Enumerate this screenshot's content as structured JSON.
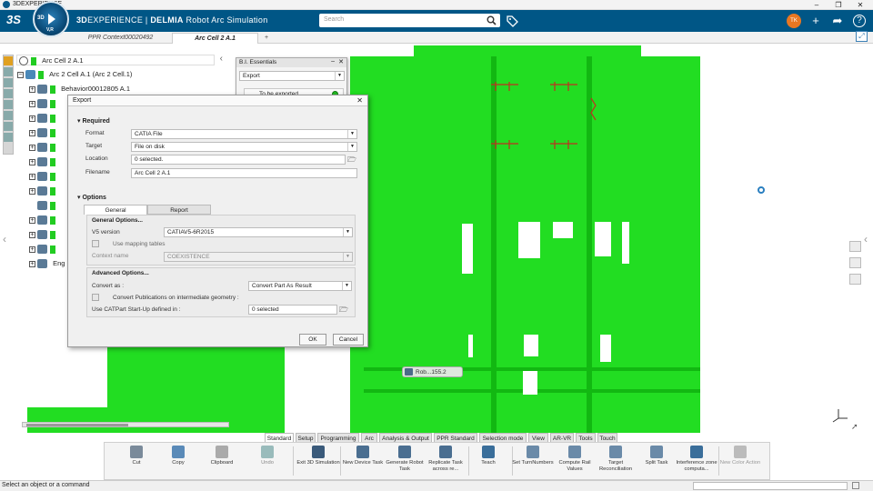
{
  "window": {
    "title": "3DEXPERIENCE",
    "minimize": "–",
    "restore": "❐",
    "close": "✕"
  },
  "topbar": {
    "brand_bold": "3D",
    "brand_rest": "EXPERIENCE | ",
    "brand_app_bold": "DELMIA",
    "brand_app": " Robot Arc Simulation",
    "compass_3d": "3D",
    "compass_version": "V,R",
    "search_placeholder": "Search",
    "user_initials": "TK",
    "icons": [
      "search-icon",
      "tag-icon",
      "add-icon",
      "share-icon",
      "help-icon"
    ],
    "add_glyph": "+",
    "share_glyph": "➦",
    "help_glyph": "?"
  },
  "tabs": {
    "items": [
      {
        "label": "PPR Context00020492"
      },
      {
        "label": "Arc Cell 2 A.1"
      }
    ],
    "add_label": "+"
  },
  "tree": {
    "collapse_arrow": "‹",
    "rows": [
      {
        "label": "Arc Cell 2 A.1"
      },
      {
        "label": "Arc 2 Cell A.1 (Arc 2 Cell.1)"
      },
      {
        "label": "Behavior00012805 A.1"
      },
      {
        "label": "Eng"
      }
    ]
  },
  "bi_essentials": {
    "title": "B.I. Essentials",
    "select_value": "Export",
    "row_label": "To be exported",
    "minimize": "–",
    "close": "✕"
  },
  "export_dialog": {
    "title": "Export",
    "close": "✕",
    "required_header": "Required",
    "format_label": "Format",
    "format_value": "CATIA File",
    "target_label": "Target",
    "target_value": "File on disk",
    "location_label": "Location",
    "location_value": "0 selected.",
    "filename_label": "Filename",
    "filename_value": "Arc Cell 2 A.1",
    "options_header": "Options",
    "subtabs": [
      "General",
      "Report"
    ],
    "general_options_header": "General Options...",
    "v5_version_label": "V5 version",
    "v5_version_value": "CATIAV5-6R2015",
    "use_mapping_label": "Use mapping tables",
    "context_name_label": "Context name",
    "context_name_value": "COEXISTENCE",
    "advanced_header": "Advanced Options...",
    "convert_as_label": "Convert as :",
    "convert_as_value": "Convert Part As Result",
    "convert_pub_label": "Convert Publications on intermediate geometry :",
    "catpart_label": "Use CATPart Start-Up defined in :",
    "catpart_value": "0 selected",
    "ok": "OK",
    "cancel": "Cancel"
  },
  "scene": {
    "tag_label": "Rob...155.2"
  },
  "section_tabs": [
    "Standard",
    "Setup",
    "Programming",
    "Arc",
    "Analysis & Output",
    "PPR Standard",
    "Selection mode",
    "View",
    "AR-VR",
    "Tools",
    "Touch"
  ],
  "actions": [
    {
      "label": "Cut",
      "icon": "scissors-icon"
    },
    {
      "label": "Copy",
      "icon": "copy-icon"
    },
    {
      "label": "Clipboard",
      "icon": "clipboard-icon"
    },
    {
      "label": "Undo",
      "icon": "undo-icon"
    },
    {
      "label": "Exit 3D Simulation",
      "icon": "exit-icon"
    },
    {
      "label": "New Device Task",
      "icon": "device-task-icon"
    },
    {
      "label": "Generate Robot Task",
      "icon": "robot-task-icon"
    },
    {
      "label": "Replicate Task across re...",
      "icon": "replicate-icon"
    },
    {
      "label": "Teach",
      "icon": "teach-icon"
    },
    {
      "label": "Set TurnNumbers",
      "icon": "turn-icon"
    },
    {
      "label": "Compute Rail Values",
      "icon": "rail-icon"
    },
    {
      "label": "Target Reconciliation",
      "icon": "target-icon"
    },
    {
      "label": "Split Task",
      "icon": "split-icon"
    },
    {
      "label": "Interference zone computa...",
      "icon": "interference-icon"
    },
    {
      "label": "New Color Action",
      "icon": "color-action-icon"
    }
  ],
  "status": {
    "text": "Select an object or a command"
  }
}
